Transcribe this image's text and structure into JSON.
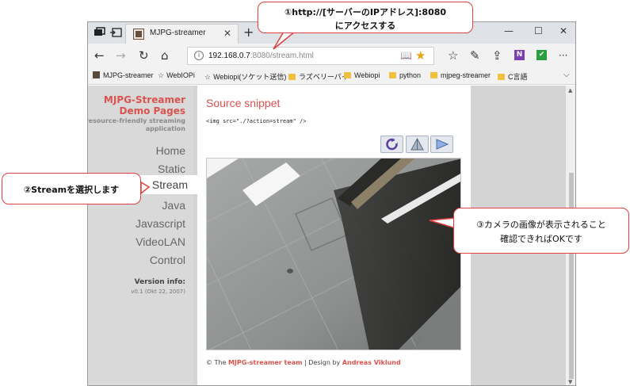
{
  "browser": {
    "tab_title": "MJPG-streamer",
    "tab_close": "✕",
    "new_tab": "+",
    "tab_list": "⌵",
    "window_controls": {
      "minimize": "—",
      "maximize": "☐",
      "close": "✕"
    },
    "nav": {
      "back": "←",
      "forward": "→",
      "refresh": "↻",
      "home": "⌂"
    },
    "address": {
      "info": "i",
      "host": "192.168.0.7",
      "rest": ":8080/stream.html",
      "reading_view": "📖",
      "favorite": "★"
    },
    "toolbar": {
      "favorites": "☆",
      "notes": "✎",
      "share": "⇪",
      "onenote": "N",
      "extension": "✔",
      "more": "···"
    },
    "favorites": [
      {
        "label": "MJPG-streamer",
        "icon": "site-icon"
      },
      {
        "label": "WebIOPi",
        "icon": "star-icon"
      },
      {
        "label": "Webiopi(ソケット送信)",
        "icon": "star-icon"
      },
      {
        "label": "ラズベリーパイ",
        "icon": "folder-icon"
      },
      {
        "label": "Webiopi",
        "icon": "folder-icon"
      },
      {
        "label": "python",
        "icon": "folder-icon"
      },
      {
        "label": "mjpeg-streamer",
        "icon": "folder-icon"
      },
      {
        "label": "C言語",
        "icon": "folder-icon"
      }
    ],
    "favorites_more": "⌵",
    "colors": {
      "accent": "#d9534f",
      "star": "#e8a317",
      "folder": "#f0c040",
      "callout_border": "#e04040"
    }
  },
  "sidebar": {
    "brand_line1": "MJPG-Streamer",
    "brand_line2": "Demo Pages",
    "tagline_line1": "a resource-friendly streaming",
    "tagline_line2": "application",
    "nav": [
      "Home",
      "Static",
      "Stream",
      "Java",
      "Javascript",
      "VideoLAN",
      "Control"
    ],
    "version_title": "Version info:",
    "version_text": "v0.1 (Okt 22, 2007)"
  },
  "main": {
    "title": "Source snippet",
    "snippet": "<img src=\"./?action=stream\" />",
    "tools": [
      "rotate-tool",
      "pyramid-tool",
      "play-tool"
    ],
    "footer": {
      "prefix": "© The ",
      "team": "MJPG-streamer team",
      "middle": " | Design by ",
      "designer": "Andreas Viklund"
    }
  },
  "callouts": {
    "c1_line1": "①http://[サーバーのIPアドレス]:8080",
    "c1_line2": "にアクセスする",
    "c2_line1": "②Streamを選択します",
    "c3_line1": "③カメラの画像が表示されること",
    "c3_line2": "確認できればOKです"
  },
  "scroll": {
    "up": "▲",
    "down": "▼"
  }
}
